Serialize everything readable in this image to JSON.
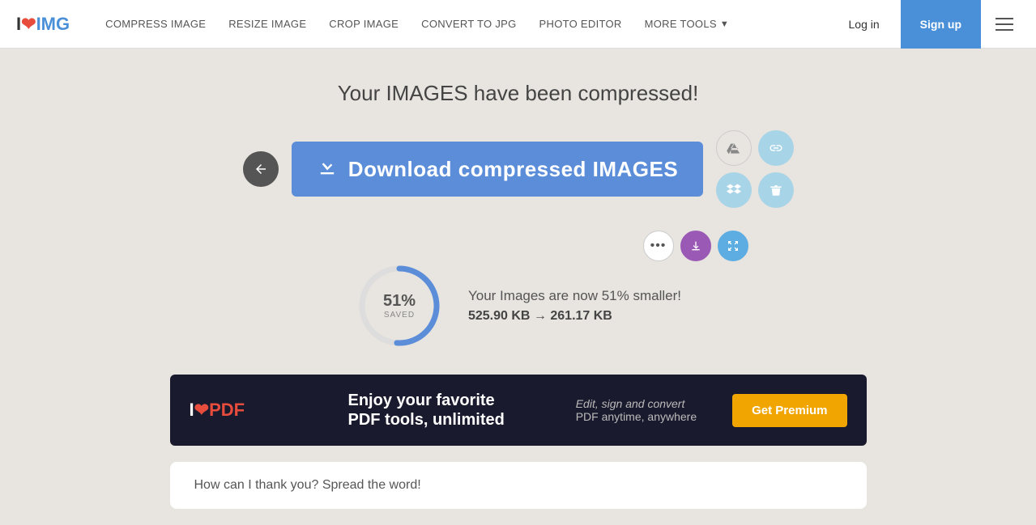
{
  "navbar": {
    "logo": "I❤IMG",
    "logo_i": "I",
    "logo_heart": "❤",
    "logo_img": "IMG",
    "links": [
      {
        "label": "COMPRESS IMAGE",
        "id": "compress"
      },
      {
        "label": "RESIZE IMAGE",
        "id": "resize"
      },
      {
        "label": "CROP IMAGE",
        "id": "crop"
      },
      {
        "label": "CONVERT TO JPG",
        "id": "convert"
      },
      {
        "label": "PHOTO EDITOR",
        "id": "photo"
      },
      {
        "label": "MORE TOOLS",
        "id": "more",
        "has_arrow": true
      }
    ],
    "login_label": "Log in",
    "signup_label": "Sign up"
  },
  "main": {
    "success_title": "Your IMAGES have been compressed!",
    "download_button_label": "Download compressed IMAGES",
    "back_label": "Back",
    "share": {
      "drive_label": "Google Drive",
      "link_label": "Copy link",
      "dropbox_label": "Dropbox",
      "trash_label": "Delete"
    },
    "small_actions": {
      "more_label": "More options",
      "download_label": "Download",
      "expand_label": "Expand"
    },
    "stats": {
      "percent": "51%",
      "saved_label": "SAVED",
      "description": "Your Images are now 51% smaller!",
      "original_size": "525.90 KB",
      "arrow": "→",
      "compressed_size": "261.17 KB",
      "sizes_display": "525.90 KB → 261.17 KB"
    },
    "circle_progress": 51
  },
  "ad": {
    "logo_i": "I",
    "logo_heart": "❤",
    "logo_pdf": "PDF",
    "headline_line1": "Enjoy your favorite",
    "headline_line2": "PDF tools, unlimited",
    "sub_text_prefix": "Edit, ",
    "sub_text_sign": "sign",
    "sub_text_suffix": " and convert",
    "sub_text2": "PDF anytime, anywhere",
    "cta_label": "Get Premium"
  },
  "bottom": {
    "title": "How can I thank you? Spread the word!"
  }
}
